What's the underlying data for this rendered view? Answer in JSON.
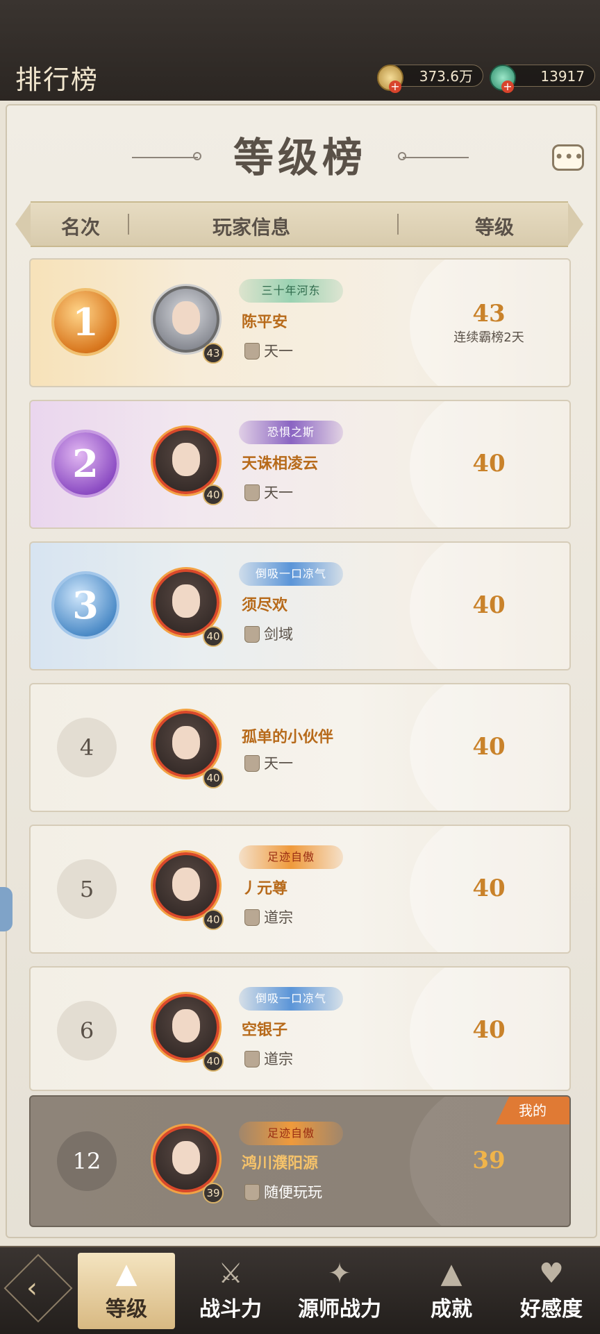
{
  "header": {
    "title": "排行榜",
    "coins": "373.6万",
    "gems": "13917"
  },
  "board": {
    "title": "等级榜",
    "columns": [
      "名次",
      "玩家信息",
      "等级"
    ]
  },
  "rows": [
    {
      "rank": "1",
      "name": "陈平安",
      "guild": "天一",
      "level": "43",
      "badge": "43",
      "title_badge": "三十年河东",
      "note": "连续霸榜2天"
    },
    {
      "rank": "2",
      "name": "天诛相凌云",
      "guild": "天一",
      "level": "40",
      "badge": "40",
      "title_badge": "恐惧之斯"
    },
    {
      "rank": "3",
      "name": "须尽欢",
      "guild": "剑域",
      "level": "40",
      "badge": "40",
      "title_badge": "倒吸一口凉气"
    },
    {
      "rank": "4",
      "name": "孤单的小伙伴",
      "guild": "天一",
      "level": "40",
      "badge": "40"
    },
    {
      "rank": "5",
      "name": "丿元尊",
      "guild": "道宗",
      "level": "40",
      "badge": "40",
      "title_badge": "足迹自傲"
    },
    {
      "rank": "6",
      "name": "空银子",
      "guild": "道宗",
      "level": "40",
      "badge": "40",
      "title_badge": "倒吸一口凉气"
    }
  ],
  "me": {
    "rank": "12",
    "name": "鸿川濮阳源",
    "guild": "随便玩玩",
    "level": "39",
    "badge": "39",
    "title_badge": "足迹自傲",
    "tag": "我的"
  },
  "nav": {
    "tabs": [
      "等级",
      "战斗力",
      "源师战力",
      "成就",
      "好感度"
    ]
  },
  "colors": {
    "accent": "#c9822a",
    "me_bg": "#8e8479",
    "me_tag": "#e07a34"
  }
}
